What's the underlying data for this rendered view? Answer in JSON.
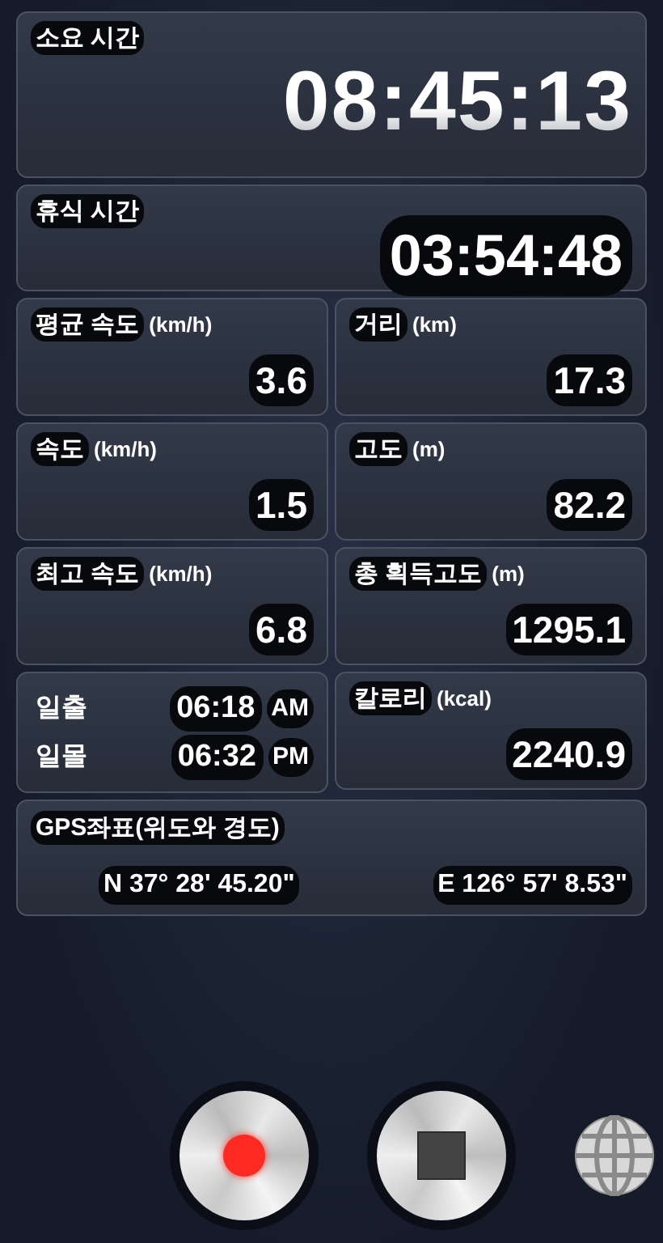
{
  "elapsed": {
    "label": "소요 시간",
    "value": "08:45:13"
  },
  "rest": {
    "label": "휴식 시간",
    "value": "03:54:48"
  },
  "cells": [
    {
      "kind": "stat",
      "label": "평균 속도",
      "unit": "(km/h)",
      "value": "3.6"
    },
    {
      "kind": "stat",
      "label": "거리",
      "unit": "(km)",
      "value": "17.3"
    },
    {
      "kind": "stat",
      "label": "속도",
      "unit": "(km/h)",
      "value": "1.5"
    },
    {
      "kind": "stat",
      "label": "고도",
      "unit": "(m)",
      "value": "82.2"
    },
    {
      "kind": "stat",
      "label": "최고 속도",
      "unit": "(km/h)",
      "value": "6.8"
    },
    {
      "kind": "stat",
      "label": "총 획득고도",
      "unit": "(m)",
      "value": "1295.1"
    },
    {
      "kind": "sun",
      "rows": [
        {
          "label": "일출",
          "time": "06:18",
          "period": "AM"
        },
        {
          "label": "일몰",
          "time": "06:32",
          "period": "PM"
        }
      ]
    },
    {
      "kind": "stat",
      "label": "칼로리",
      "unit": "(kcal)",
      "value": "2240.9"
    }
  ],
  "gps": {
    "label": "GPS좌표(위도와 경도)",
    "latitude": "N 37° 28' 45.20\"",
    "longitude": "E 126° 57' 8.53\""
  }
}
